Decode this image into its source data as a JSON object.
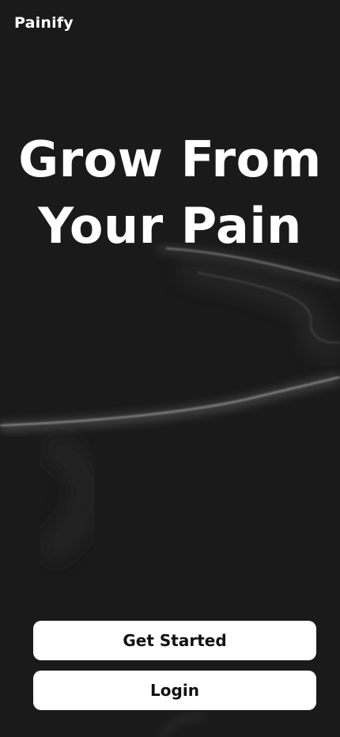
{
  "app": {
    "brand": "Painify"
  },
  "hero": {
    "line1": "Grow From",
    "line2": "Your Pain"
  },
  "actions": {
    "get_started_label": "Get Started",
    "login_label": "Login"
  },
  "colors": {
    "background": "#1a1a1a",
    "text": "#ffffff",
    "button_bg": "#ffffff",
    "button_text": "#111111"
  }
}
